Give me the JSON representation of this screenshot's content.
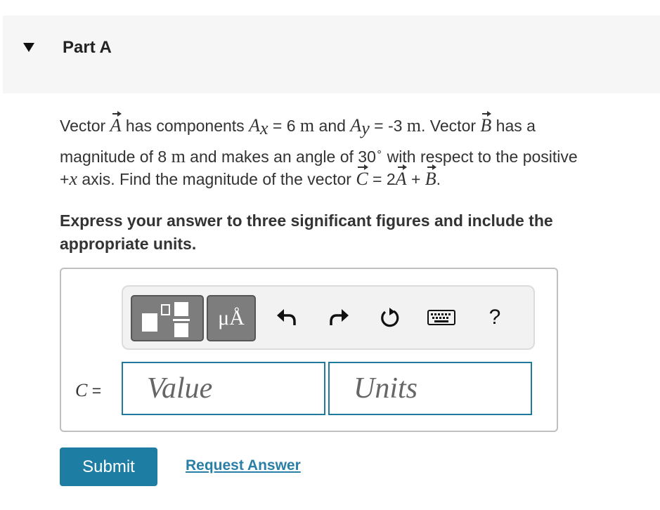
{
  "part": {
    "title": "Part A"
  },
  "problem": {
    "l1_a": "Vector ",
    "vecA": "A",
    "l1_b": " has components ",
    "Ax_sym": "A",
    "x_sub": "x",
    "eq1": " = 6 ",
    "m1": "m",
    "l1_c": " and ",
    "Ay_sym": "A",
    "y_sub": "y",
    "eq2": " = -3 ",
    "m2": "m",
    "l1_d": ". Vector ",
    "vecB": "B",
    "l1_e": " has a",
    "l2_a": "magnitude of 8 ",
    "m3": "m",
    "l2_b": " and makes an angle of 30",
    "deg": "∘",
    "l2_c": " with respect to the positive",
    "l3_a": "+",
    "x_axis": "x",
    "l3_b": " axis. Find the magnitude of the vector ",
    "vecC": "C",
    "l3_c": " = 2",
    "vecA2": "A",
    "l3_d": " + ",
    "vecB2": "B",
    "l3_e": "."
  },
  "instruction": "Express your answer to three significant figures and include the appropriate units.",
  "answer": {
    "label_var": "C",
    "label_eq": " =",
    "value_placeholder": "Value",
    "units_placeholder": "Units"
  },
  "toolbar": {
    "units_label": "μÅ",
    "help_label": "?"
  },
  "actions": {
    "submit": "Submit",
    "request_answer": "Request Answer"
  }
}
